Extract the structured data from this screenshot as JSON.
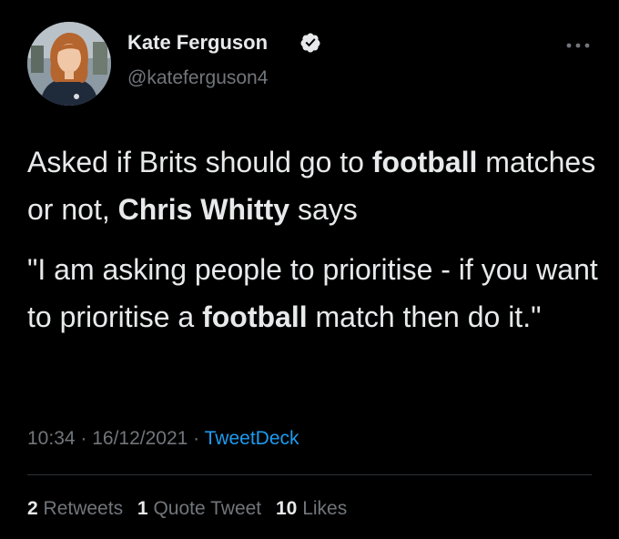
{
  "author": {
    "name": "Kate Ferguson",
    "handle": "@kateferguson4",
    "verified": true
  },
  "tweet": {
    "para1": {
      "t1": "Asked if Brits should go to ",
      "b1": "football",
      "t2": " matches or not, ",
      "b2": "Chris Whitty",
      "t3": " says"
    },
    "para2": {
      "t1": "\"I am asking people to prioritise - if you want to prioritise a ",
      "b1": "football",
      "t2": " match then do it.\""
    }
  },
  "meta": {
    "time": "10:34",
    "sep1": " · ",
    "date": "16/12/2021",
    "sep2": " · ",
    "source": "TweetDeck"
  },
  "stats": {
    "retweets_count": "2",
    "retweets_label": "Retweets",
    "quotes_count": "1",
    "quotes_label": "Quote Tweet",
    "likes_count": "10",
    "likes_label": "Likes"
  },
  "colors": {
    "background": "#000000",
    "text": "#e7e9ea",
    "secondary": "#71767b",
    "link": "#1d9bf0",
    "divider": "#2f3336"
  },
  "icons": {
    "verified": "verified-badge-icon",
    "more": "more-options-icon"
  }
}
